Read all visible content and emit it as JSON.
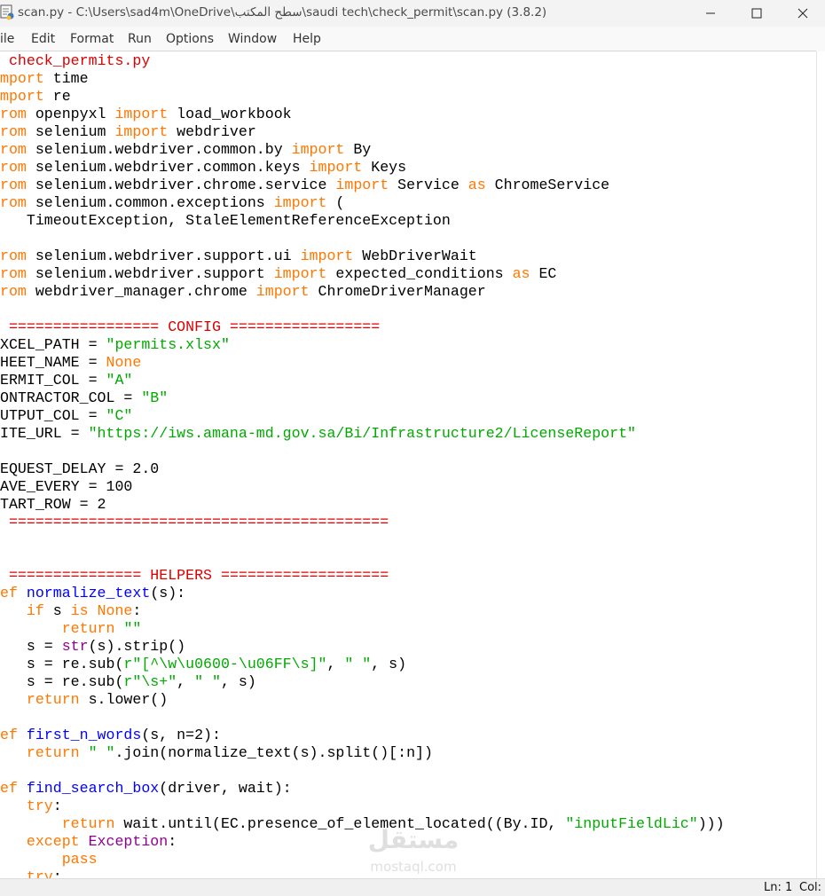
{
  "window": {
    "title": "scan.py - C:\\Users\\sad4m\\OneDrive\\سطح المكتب\\saudi tech\\check_permit\\scan.py (3.8.2)",
    "minimize_glyph": "–",
    "maximize_glyph": "☐",
    "close_glyph": "✕"
  },
  "menu": [
    "ile",
    "Edit",
    "Format",
    "Run",
    "Options",
    "Window",
    "Help"
  ],
  "status": {
    "line": "Ln: 1",
    "col": "Col:"
  },
  "watermark": {
    "arabic": "مستقل",
    "latin": "mostaql.com"
  },
  "code_lines": [
    [
      [
        "c",
        " check_permits.py"
      ]
    ],
    [
      [
        "k",
        "mport"
      ],
      [
        "",
        " time"
      ]
    ],
    [
      [
        "k",
        "mport"
      ],
      [
        "",
        " re"
      ]
    ],
    [
      [
        "k",
        "rom"
      ],
      [
        "",
        " openpyxl "
      ],
      [
        "k",
        "import"
      ],
      [
        "",
        " load_workbook"
      ]
    ],
    [
      [
        "k",
        "rom"
      ],
      [
        "",
        " selenium "
      ],
      [
        "k",
        "import"
      ],
      [
        "",
        " webdriver"
      ]
    ],
    [
      [
        "k",
        "rom"
      ],
      [
        "",
        " selenium.webdriver.common.by "
      ],
      [
        "k",
        "import"
      ],
      [
        "",
        " By"
      ]
    ],
    [
      [
        "k",
        "rom"
      ],
      [
        "",
        " selenium.webdriver.common.keys "
      ],
      [
        "k",
        "import"
      ],
      [
        "",
        " Keys"
      ]
    ],
    [
      [
        "k",
        "rom"
      ],
      [
        "",
        " selenium.webdriver.chrome.service "
      ],
      [
        "k",
        "import"
      ],
      [
        "",
        " Service "
      ],
      [
        "k",
        "as"
      ],
      [
        "",
        " ChromeService"
      ]
    ],
    [
      [
        "k",
        "rom"
      ],
      [
        "",
        " selenium.common.exceptions "
      ],
      [
        "k",
        "import"
      ],
      [
        "",
        " ("
      ]
    ],
    [
      [
        "",
        "   TimeoutException, StaleElementReferenceException"
      ]
    ],
    [
      [
        "",
        ""
      ]
    ],
    [
      [
        "k",
        "rom"
      ],
      [
        "",
        " selenium.webdriver.support.ui "
      ],
      [
        "k",
        "import"
      ],
      [
        "",
        " WebDriverWait"
      ]
    ],
    [
      [
        "k",
        "rom"
      ],
      [
        "",
        " selenium.webdriver.support "
      ],
      [
        "k",
        "import"
      ],
      [
        "",
        " expected_conditions "
      ],
      [
        "k",
        "as"
      ],
      [
        "",
        " EC"
      ]
    ],
    [
      [
        "k",
        "rom"
      ],
      [
        "",
        " webdriver_manager.chrome "
      ],
      [
        "k",
        "import"
      ],
      [
        "",
        " ChromeDriverManager"
      ]
    ],
    [
      [
        "",
        ""
      ]
    ],
    [
      [
        "c",
        " ================= CONFIG ================="
      ]
    ],
    [
      [
        "",
        "XCEL_PATH = "
      ],
      [
        "s",
        "\"permits.xlsx\""
      ]
    ],
    [
      [
        "",
        "HEET_NAME = "
      ],
      [
        "k",
        "None"
      ]
    ],
    [
      [
        "",
        "ERMIT_COL = "
      ],
      [
        "s",
        "\"A\""
      ]
    ],
    [
      [
        "",
        "ONTRACTOR_COL = "
      ],
      [
        "s",
        "\"B\""
      ]
    ],
    [
      [
        "",
        "UTPUT_COL = "
      ],
      [
        "s",
        "\"C\""
      ]
    ],
    [
      [
        "",
        "ITE_URL = "
      ],
      [
        "s",
        "\"https://iws.amana-md.gov.sa/Bi/Infrastructure2/LicenseReport\""
      ]
    ],
    [
      [
        "",
        ""
      ]
    ],
    [
      [
        "",
        "EQUEST_DELAY = 2.0"
      ]
    ],
    [
      [
        "",
        "AVE_EVERY = 100"
      ]
    ],
    [
      [
        "",
        "TART_ROW = 2"
      ]
    ],
    [
      [
        "c",
        " ==========================================="
      ]
    ],
    [
      [
        "",
        ""
      ]
    ],
    [
      [
        "",
        ""
      ]
    ],
    [
      [
        "c",
        " =============== HELPERS ==================="
      ]
    ],
    [
      [
        "k",
        "ef"
      ],
      [
        "",
        " "
      ],
      [
        "d",
        "normalize_text"
      ],
      [
        "",
        "(s):"
      ]
    ],
    [
      [
        "",
        "   "
      ],
      [
        "k",
        "if"
      ],
      [
        "",
        " s "
      ],
      [
        "k",
        "is"
      ],
      [
        "",
        " "
      ],
      [
        "k",
        "None"
      ],
      [
        "",
        ":"
      ]
    ],
    [
      [
        "",
        "       "
      ],
      [
        "k",
        "return"
      ],
      [
        "",
        " "
      ],
      [
        "s",
        "\"\""
      ]
    ],
    [
      [
        "",
        "   s = "
      ],
      [
        "b",
        "str"
      ],
      [
        "",
        "(s).strip()"
      ]
    ],
    [
      [
        "",
        "   s = re.sub("
      ],
      [
        "s",
        "r\"[^\\w\\u0600-\\u06FF\\s]\""
      ],
      [
        "",
        ", "
      ],
      [
        "s",
        "\" \""
      ],
      [
        "",
        ", s)"
      ]
    ],
    [
      [
        "",
        "   s = re.sub("
      ],
      [
        "s",
        "r\"\\s+\""
      ],
      [
        "",
        ", "
      ],
      [
        "s",
        "\" \""
      ],
      [
        "",
        ", s)"
      ]
    ],
    [
      [
        "",
        "   "
      ],
      [
        "k",
        "return"
      ],
      [
        "",
        " s.lower()"
      ]
    ],
    [
      [
        "",
        ""
      ]
    ],
    [
      [
        "k",
        "ef"
      ],
      [
        "",
        " "
      ],
      [
        "d",
        "first_n_words"
      ],
      [
        "",
        "(s, n=2):"
      ]
    ],
    [
      [
        "",
        "   "
      ],
      [
        "k",
        "return"
      ],
      [
        "",
        " "
      ],
      [
        "s",
        "\" \""
      ],
      [
        "",
        ".join(normalize_text(s).split()[:n])"
      ]
    ],
    [
      [
        "",
        ""
      ]
    ],
    [
      [
        "k",
        "ef"
      ],
      [
        "",
        " "
      ],
      [
        "d",
        "find_search_box"
      ],
      [
        "",
        "(driver, wait):"
      ]
    ],
    [
      [
        "",
        "   "
      ],
      [
        "k",
        "try"
      ],
      [
        "",
        ":"
      ]
    ],
    [
      [
        "",
        "       "
      ],
      [
        "k",
        "return"
      ],
      [
        "",
        " wait.until(EC.presence_of_element_located((By.ID, "
      ],
      [
        "s",
        "\"inputFieldLic\""
      ],
      [
        "",
        ")))"
      ]
    ],
    [
      [
        "",
        "   "
      ],
      [
        "k",
        "except"
      ],
      [
        "",
        " "
      ],
      [
        "b",
        "Exception"
      ],
      [
        "",
        ":"
      ]
    ],
    [
      [
        "",
        "       "
      ],
      [
        "k",
        "pass"
      ]
    ],
    [
      [
        "",
        "   "
      ],
      [
        "k",
        "try"
      ],
      [
        "",
        ":"
      ]
    ]
  ]
}
